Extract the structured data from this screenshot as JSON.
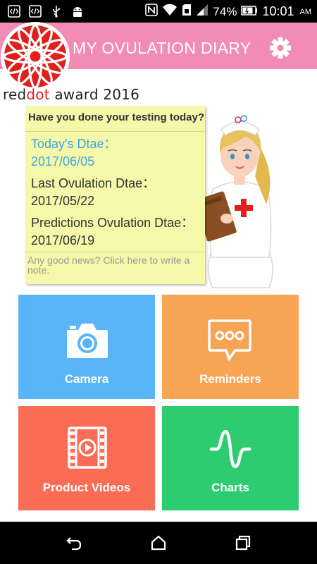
{
  "status_bar": {
    "battery_percent": "74%",
    "time": "10:01",
    "ampm": "AM",
    "icons": [
      "code-icon",
      "code-icon",
      "usb-icon",
      "android-icon",
      "nfc-icon",
      "wifi-icon",
      "sd-card-icon",
      "signal-icon",
      "battery-icon"
    ]
  },
  "app_bar": {
    "title": "MY OVULATION DIARY",
    "settings_icon": "gear-icon",
    "color": "#f28bb5"
  },
  "award": {
    "red_word_1": "red",
    "red_word_2": "dot",
    "rest": " award 2016"
  },
  "note": {
    "question": "Have you done your testing today?",
    "today_label": "Today's Dtae：",
    "today_value": "2017/06/05",
    "last_label": "Last Ovulation Dtae：",
    "last_value": "2017/05/22",
    "prediction_label": "Predictions Ovulation Dtae：",
    "prediction_value": "2017/06/19",
    "write_prompt": "Any good news? Click here to write a note."
  },
  "tiles": [
    {
      "label": "Camera",
      "icon": "camera-icon",
      "color": "#5ab4f8"
    },
    {
      "label": "Reminders",
      "icon": "chat-bubble-icon",
      "color": "#f7a455"
    },
    {
      "label": "Product Videos",
      "icon": "film-play-icon",
      "color": "#fb6c55"
    },
    {
      "label": "Charts",
      "icon": "wave-icon",
      "color": "#2ecc71"
    }
  ],
  "nav_bar": {
    "buttons": [
      "back-icon",
      "home-icon",
      "recents-icon"
    ]
  }
}
